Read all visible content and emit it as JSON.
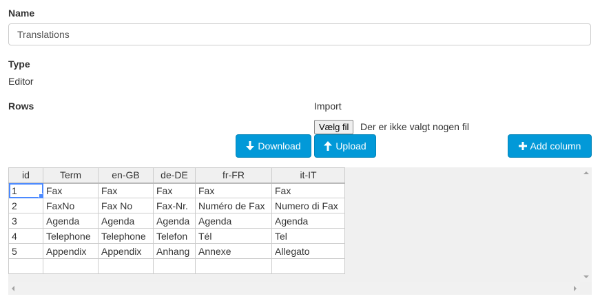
{
  "name_field": {
    "label": "Name",
    "value": "Translations"
  },
  "type_field": {
    "label": "Type",
    "value": "Editor"
  },
  "rows_section": {
    "label": "Rows"
  },
  "import": {
    "label": "Import",
    "choose_file_label": "Vælg fil",
    "no_file_text": "Der er ikke valgt nogen fil"
  },
  "buttons": {
    "download": "Download",
    "upload": "Upload",
    "add_column": "Add column"
  },
  "grid": {
    "columns": [
      "id",
      "Term",
      "en-GB",
      "de-DE",
      "fr-FR",
      "it-IT"
    ],
    "rows": [
      [
        "1",
        "Fax",
        "Fax",
        "Fax",
        "Fax",
        "Fax"
      ],
      [
        "2",
        "FaxNo",
        "Fax No",
        "Fax-Nr.",
        "Numéro de Fax",
        "Numero di Fax"
      ],
      [
        "3",
        "Agenda",
        "Agenda",
        "Agenda",
        "Agenda",
        "Agenda"
      ],
      [
        "4",
        "Telephone",
        "Telephone",
        "Telefon",
        "Tél",
        "Tel"
      ],
      [
        "5",
        "Appendix",
        "Appendix",
        "Anhang",
        "Annexe",
        "Allegato"
      ],
      [
        "",
        "",
        "",
        "",
        "",
        ""
      ]
    ]
  },
  "colors": {
    "button_bg": "#0299d8",
    "selection": "#4b89ff"
  }
}
